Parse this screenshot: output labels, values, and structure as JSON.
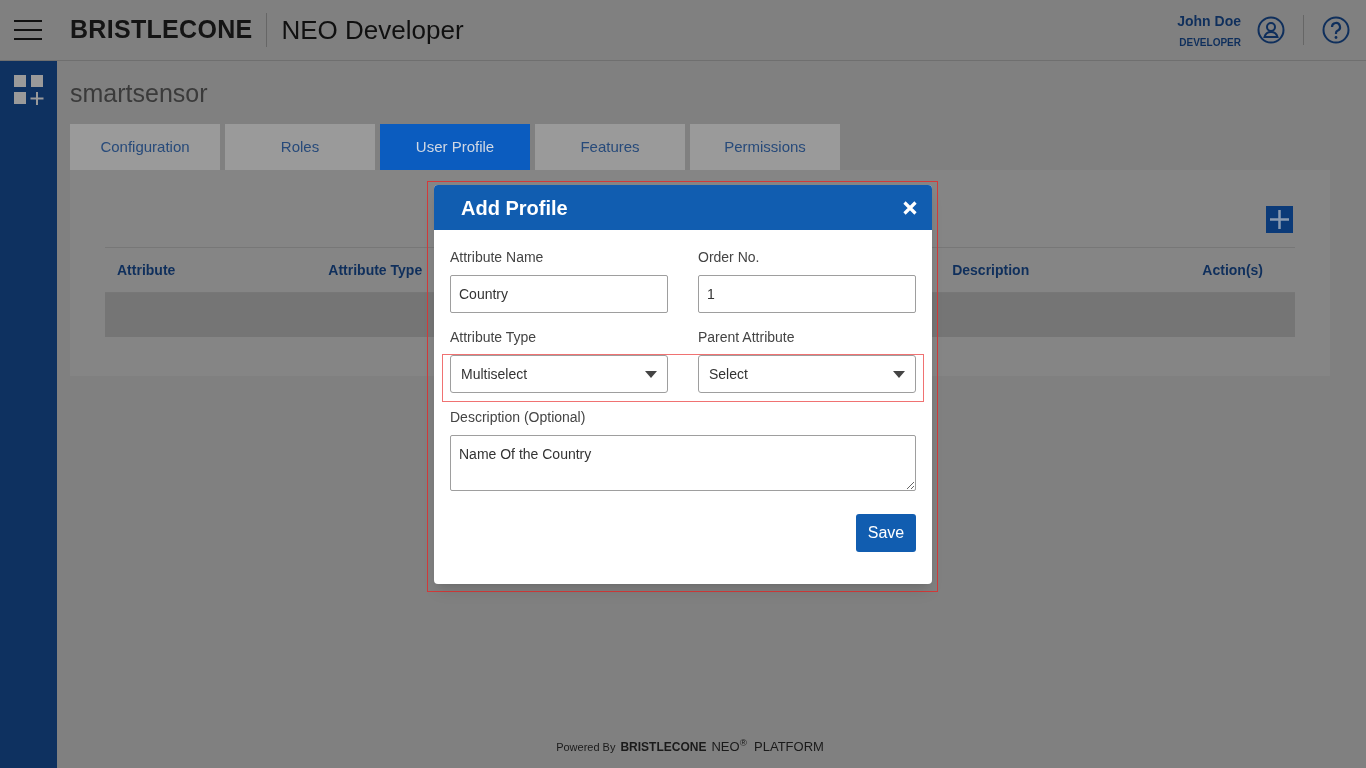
{
  "header": {
    "logo": "BRISTLECONE",
    "app_title": "NEO Developer",
    "user_name": "John Doe",
    "user_role": "DEVELOPER"
  },
  "page_title": "smartsensor",
  "tabs": [
    {
      "label": "Configuration",
      "selected": false
    },
    {
      "label": "Roles",
      "selected": false
    },
    {
      "label": "User Profile",
      "selected": true
    },
    {
      "label": "Features",
      "selected": false
    },
    {
      "label": "Permissions",
      "selected": false
    }
  ],
  "table": {
    "columns": [
      "Attribute",
      "Attribute Type",
      "Description",
      "Action(s)"
    ]
  },
  "modal": {
    "title": "Add Profile",
    "rows": [
      {
        "highlighted": false,
        "fields": [
          {
            "kind": "text",
            "label": "Attribute Name",
            "value": "Country"
          },
          {
            "kind": "text",
            "label": "Order No.",
            "value": "1"
          }
        ]
      },
      {
        "highlighted": true,
        "fields": [
          {
            "kind": "select",
            "label": "Attribute Type",
            "value": "Multiselect"
          },
          {
            "kind": "select",
            "label": "Parent Attribute",
            "value": "Select"
          }
        ]
      },
      {
        "highlighted": false,
        "fields": [
          {
            "kind": "textarea",
            "label": "Description (Optional)",
            "value": "Name Of the Country"
          }
        ]
      }
    ],
    "save_button": "Save"
  },
  "footer": {
    "prefix": "Powered By",
    "brand": "BRISTLECONE",
    "product": "NEO$^{®}$  PLATFORM"
  }
}
